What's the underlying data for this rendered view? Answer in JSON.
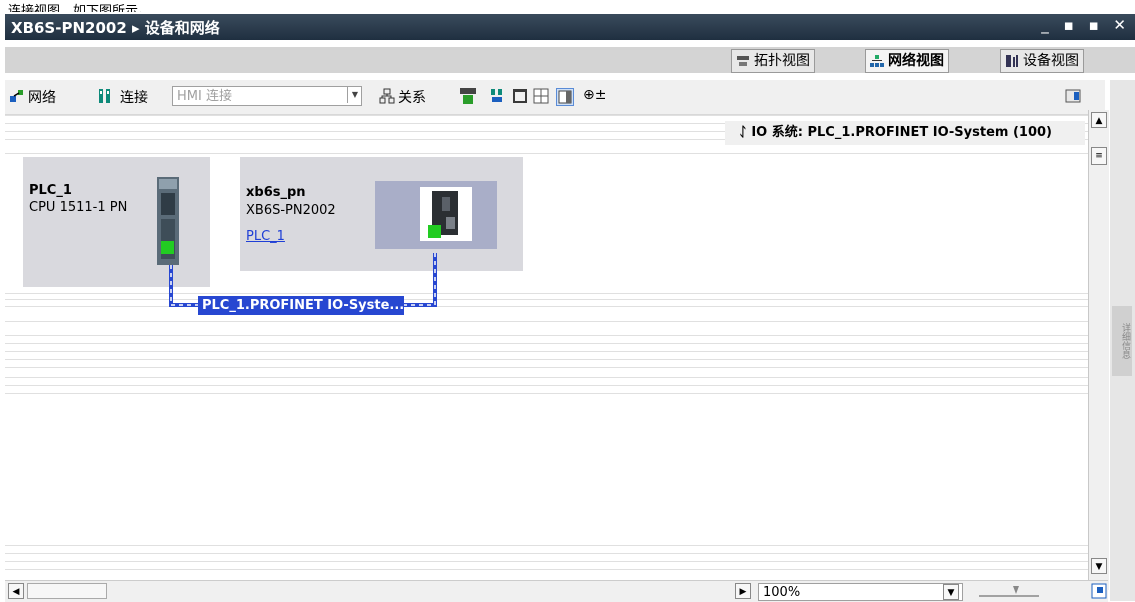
{
  "top_caption": "连接视图，如下图所示。",
  "title": {
    "text": "XB6S-PN2002 ▸ 设备和网络",
    "controls": "_ ▪ ▪ ✕"
  },
  "view_tabs": [
    {
      "label": "拓扑视图",
      "icon": "topology-icon"
    },
    {
      "label": "网络视图",
      "icon": "network-view-icon"
    },
    {
      "label": "设备视图",
      "icon": "device-view-icon"
    }
  ],
  "toolbar": {
    "network_label": "网络",
    "connect_label": "连接",
    "hmi_placeholder": "HMI 连接",
    "relation_label": "关系",
    "zoom_icon_text": "⊕±"
  },
  "io_system": {
    "pin": "ᛇ",
    "label": "IO 系统: PLC_1.PROFINET IO-System (100)"
  },
  "devices": {
    "plc": {
      "name": "PLC_1",
      "type": "CPU 1511-1 PN"
    },
    "xb6s": {
      "name": "xb6s_pn",
      "type": "XB6S-PN2002",
      "link": "PLC_1"
    }
  },
  "network_label": "PLC_1.PROFINET IO-Syste...",
  "zoom": {
    "value": "100%"
  },
  "side_panel_text": "详细信息",
  "colors": {
    "titlebar": "#2c3e50",
    "network_line": "#2747d1",
    "port": "#22cc22",
    "link": "#1f3fd6"
  }
}
